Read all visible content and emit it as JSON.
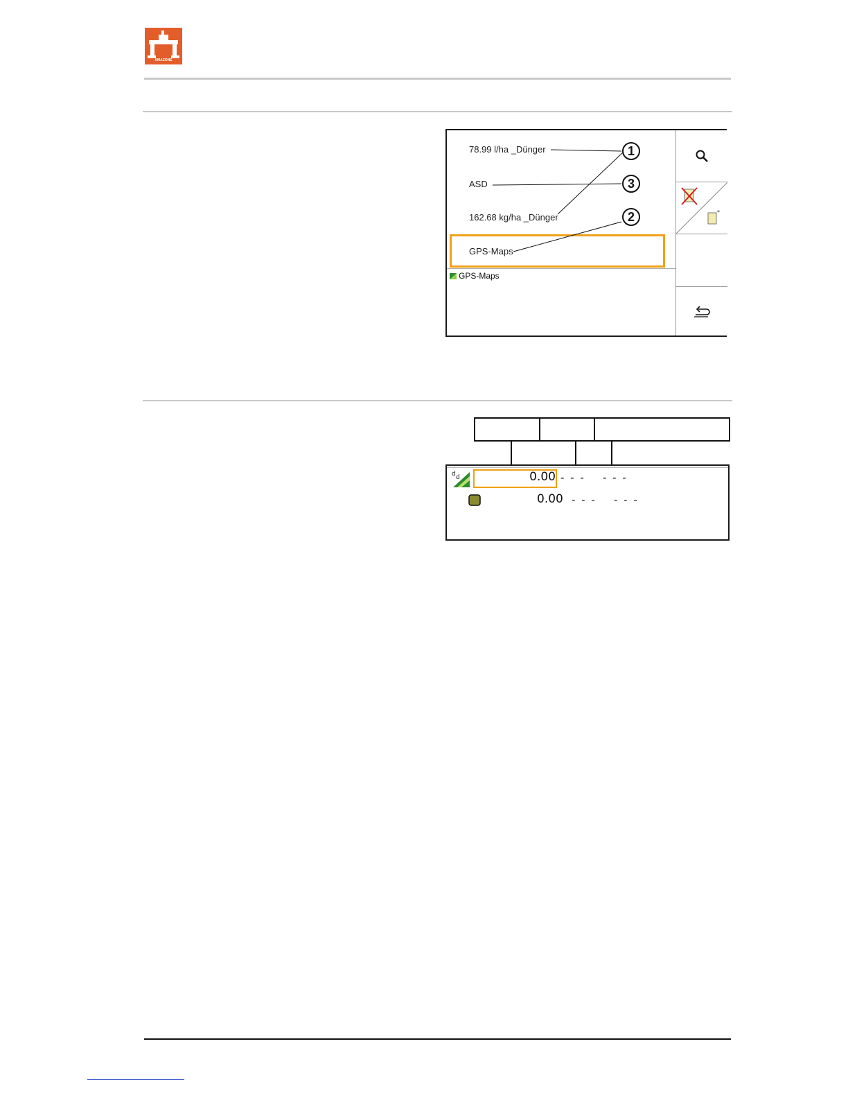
{
  "header": {
    "logo_text": "AMAZONE",
    "logo_icon": "amazone-logo"
  },
  "screen1": {
    "items": [
      {
        "label": "78.99 l/ha _Dünger"
      },
      {
        "label": "ASD"
      },
      {
        "label": "162.68 kg/ha _Dünger"
      },
      {
        "label": "GPS-Maps"
      }
    ],
    "current_path": "GPS-Maps",
    "callouts": [
      "1",
      "3",
      "2"
    ],
    "sidebar_icons": [
      "search-icon",
      "delete-new-file-icon",
      "empty",
      "back-icon"
    ],
    "selection_color": "#f0a018"
  },
  "screen2": {
    "rows": [
      {
        "icon": "target-rate-icon",
        "value": "0.00",
        "col2": "- - -",
        "col3": "- - -"
      },
      {
        "icon": "product-bag-icon",
        "value": "0.00",
        "col2": "- - -",
        "col3": "- - -"
      }
    ]
  }
}
